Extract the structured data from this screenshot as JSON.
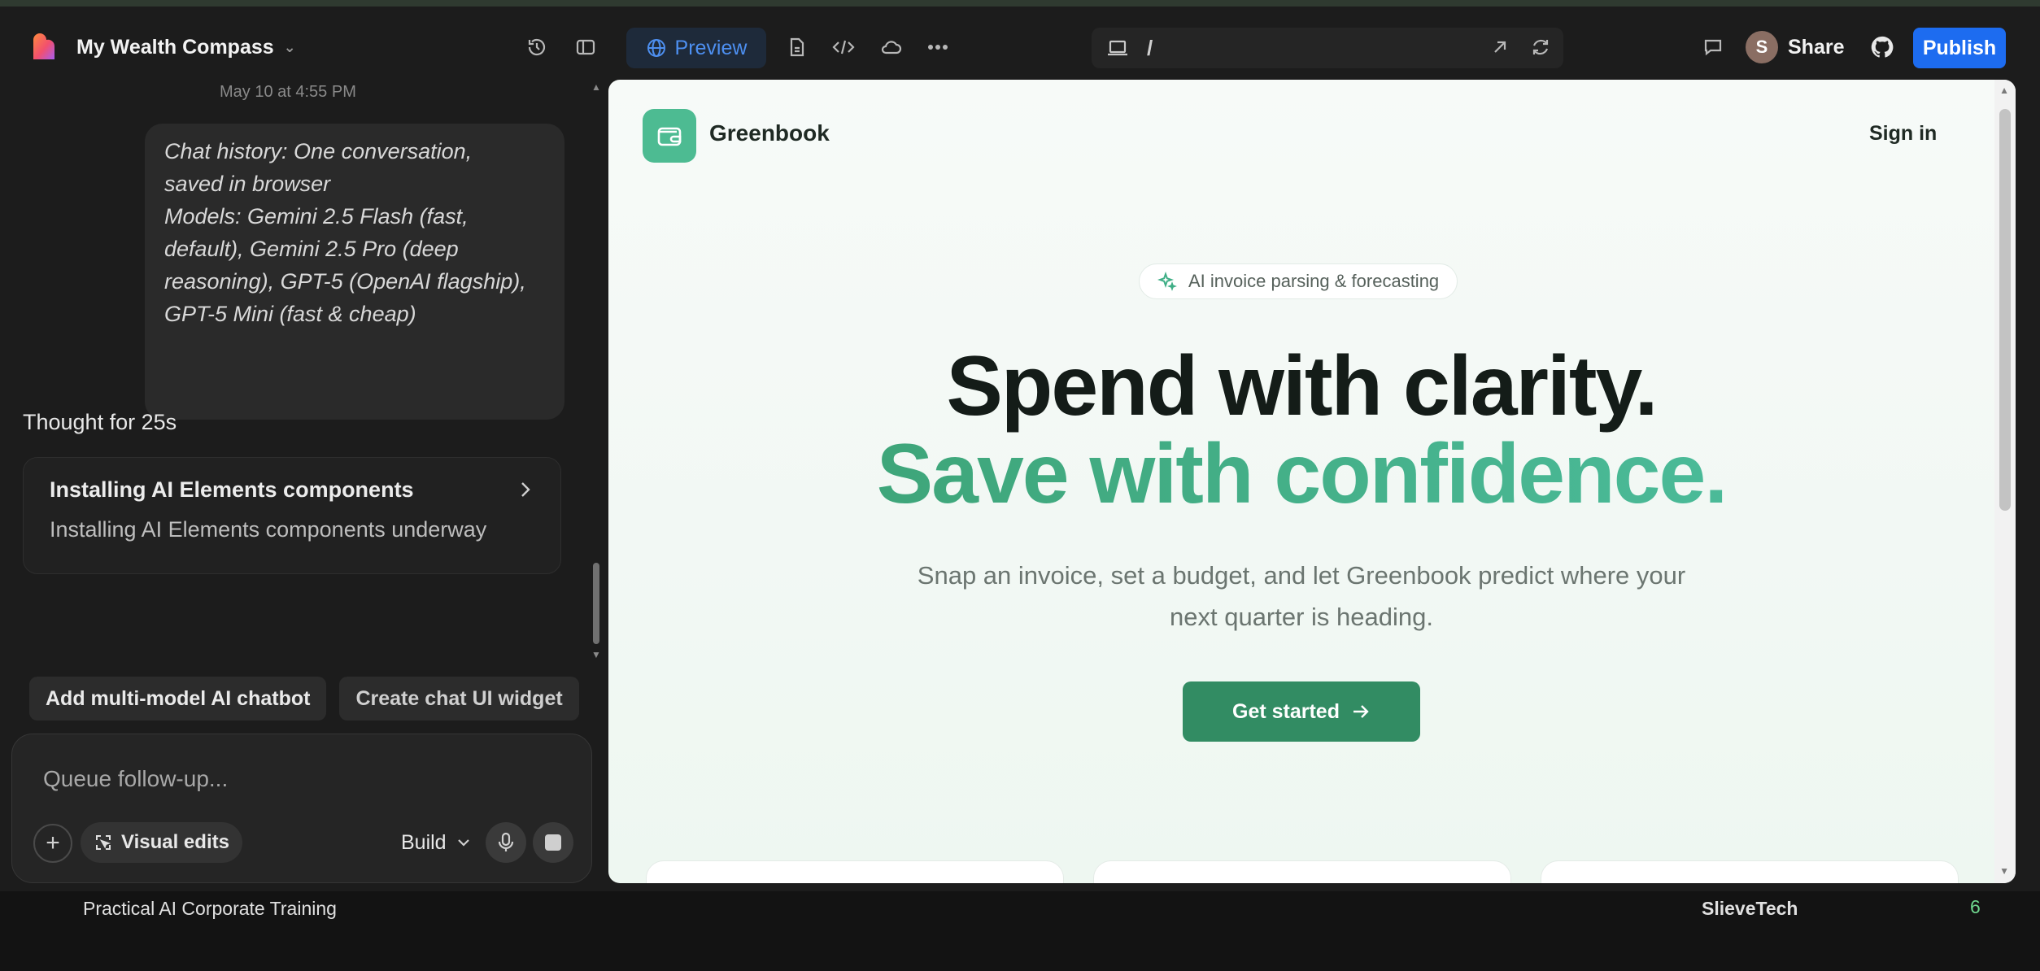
{
  "topbar": {
    "project_name": "My Wealth Compass",
    "preview_label": "Preview",
    "url_path": "/",
    "avatar_initial": "S",
    "share_label": "Share",
    "publish_label": "Publish"
  },
  "chat": {
    "timestamp": "May 10 at 4:55 PM",
    "message_lines": [
      "Chat history: One conversation,",
      "saved in browser",
      "Models: Gemini 2.5 Flash (fast,",
      "default), Gemini 2.5 Pro (deep",
      "reasoning), GPT-5 (OpenAI flagship),",
      "GPT-5 Mini (fast & cheap)"
    ],
    "thought_label": "Thought for 25s",
    "task_title": "Installing AI Elements components",
    "task_subtitle": "Installing AI Elements components underway",
    "suggestions": [
      "Add multi-model AI chatbot",
      "Create chat UI widget"
    ],
    "composer_placeholder": "Queue follow-up...",
    "visual_edits_label": "Visual edits",
    "mode_label": "Build"
  },
  "preview": {
    "brand": "Greenbook",
    "signin": "Sign in",
    "badge": "AI invoice parsing & forecasting",
    "headline_1": "Spend with clarity.",
    "headline_2": "Save with confidence.",
    "subtitle_lines": [
      "Snap an invoice, set a budget, and let Greenbook predict where your",
      "next quarter is heading."
    ],
    "cta": "Get started"
  },
  "caption": {
    "left": "Practical AI Corporate Training",
    "center": "SlieveTech",
    "number": "6"
  },
  "colors": {
    "accent_blue": "#1d6cf0",
    "brand_green": "#328c63",
    "headline_green": "#3fae86"
  }
}
